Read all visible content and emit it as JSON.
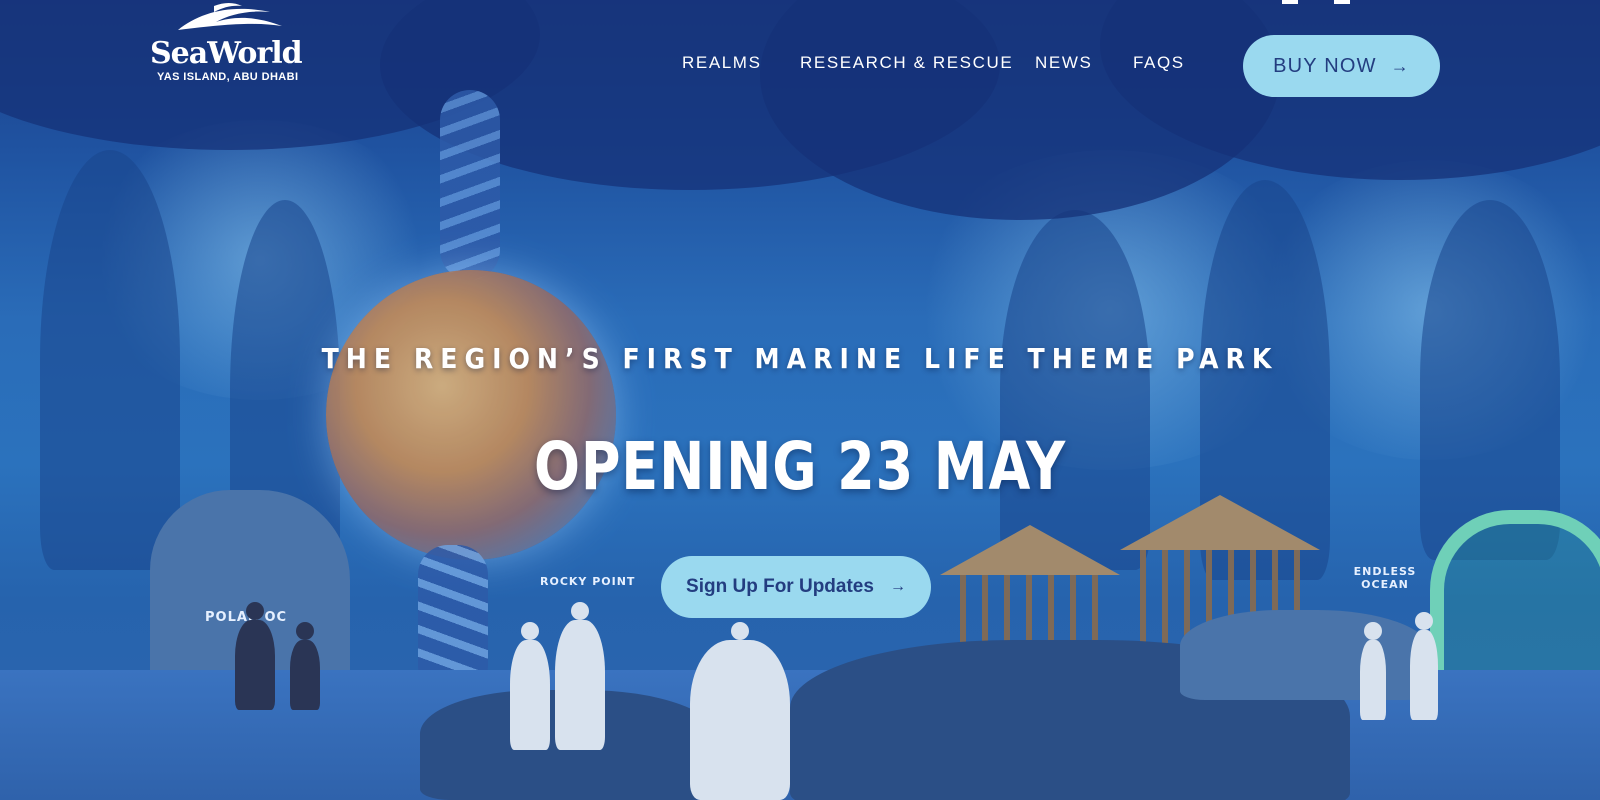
{
  "brand": {
    "name": "SeaWorld",
    "location": "YAS ISLAND, ABU DHABI",
    "logo_icon": "orca-wave-icon"
  },
  "nav": {
    "items": [
      {
        "label": "REALMS"
      },
      {
        "label": "RESEARCH & RESCUE"
      },
      {
        "label": "NEWS"
      },
      {
        "label": "FAQS"
      }
    ],
    "buy_label": "BUY NOW",
    "buy_icon": "arrow-right-icon"
  },
  "hero": {
    "kicker": "THE REGION’S FIRST MARINE LIFE THEME PARK",
    "headline": "OPENING 23 MAY",
    "cta_label": "Sign Up For Updates",
    "cta_icon": "arrow-right-icon"
  },
  "scene_signs": {
    "polar": "POLAR OC",
    "rocky": "ROCKY POINT",
    "endless": "ENDLESS OCEAN"
  },
  "colors": {
    "overlay": "#1f52a0",
    "button_bg": "#9ad9ef",
    "button_text": "#233d80",
    "text": "#ffffff"
  }
}
